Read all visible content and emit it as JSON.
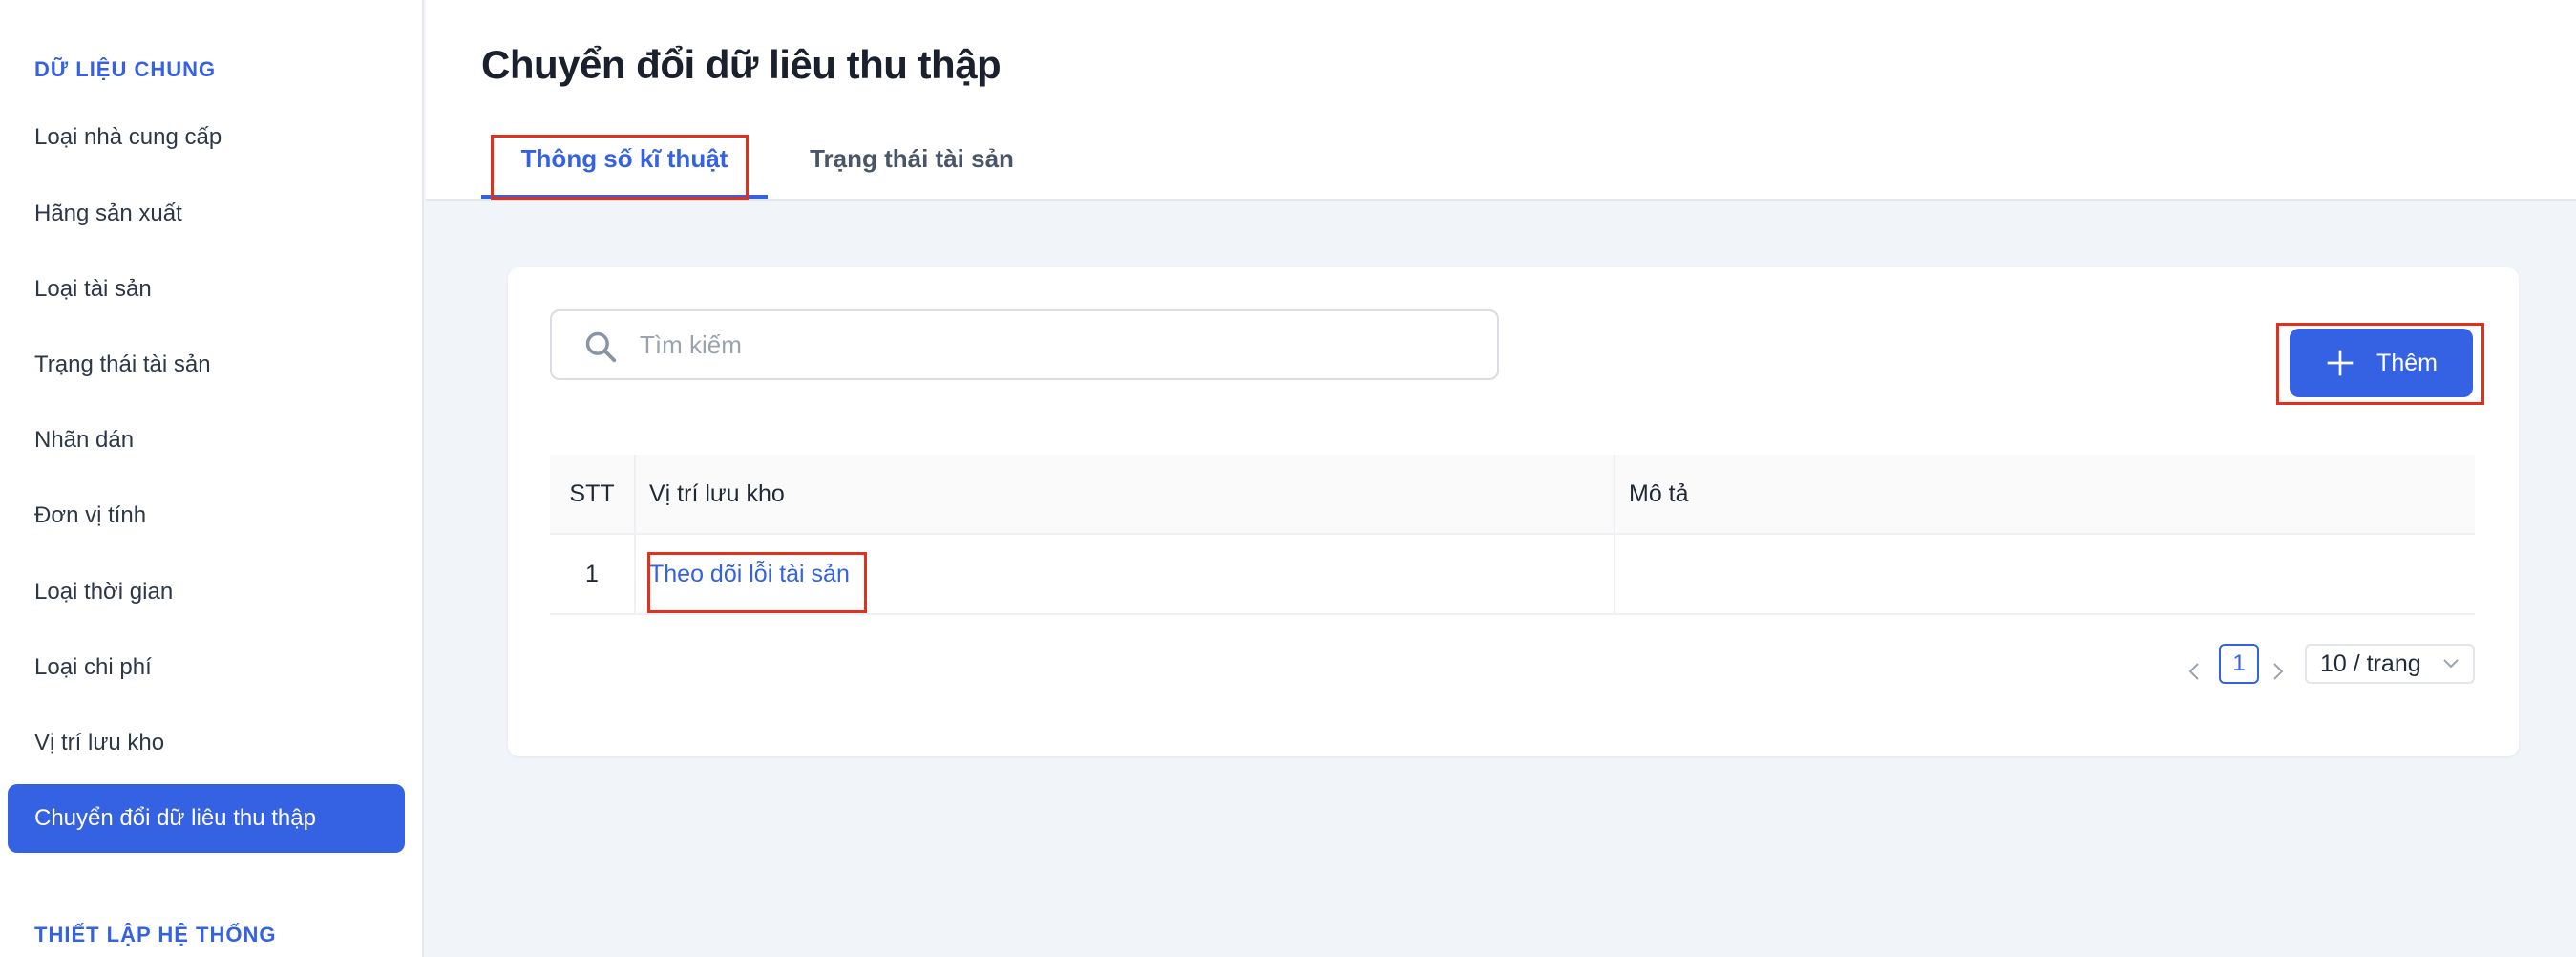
{
  "sidebar": {
    "section_general": "DỮ LIỆU CHUNG",
    "items": [
      {
        "label": "Loại nhà cung cấp"
      },
      {
        "label": "Hãng sản xuất"
      },
      {
        "label": "Loại tài sản"
      },
      {
        "label": "Trạng thái tài sản"
      },
      {
        "label": "Nhãn dán"
      },
      {
        "label": "Đơn vị tính"
      },
      {
        "label": "Loại thời gian"
      },
      {
        "label": "Loại chi phí"
      },
      {
        "label": "Vị trí lưu kho"
      },
      {
        "label": "Chuyển đổi dữ liêu thu thập",
        "active": true
      }
    ],
    "section_system": "THIẾT LẬP HỆ THỐNG"
  },
  "header": {
    "title": "Chuyển đổi dữ liêu thu thập",
    "tabs": [
      {
        "label": "Thông số kĩ thuật",
        "active": true
      },
      {
        "label": "Trạng thái tài sản"
      }
    ]
  },
  "search": {
    "placeholder": "Tìm kiếm",
    "value": ""
  },
  "toolbar": {
    "add_label": "Thêm"
  },
  "table": {
    "columns": [
      "STT",
      "Vị trí lưu kho",
      "Mô tả"
    ],
    "rows": [
      {
        "stt": "1",
        "location": "Theo dõi lỗi tài sản",
        "description": ""
      }
    ]
  },
  "pagination": {
    "prev_icon": "chevron-left-icon",
    "current_page": "1",
    "next_icon": "chevron-right-icon",
    "page_size": "10 / trang"
  },
  "colors": {
    "primary": "#3561e3",
    "highlight_box": "#e0311f",
    "background": "#f1f4f8"
  }
}
